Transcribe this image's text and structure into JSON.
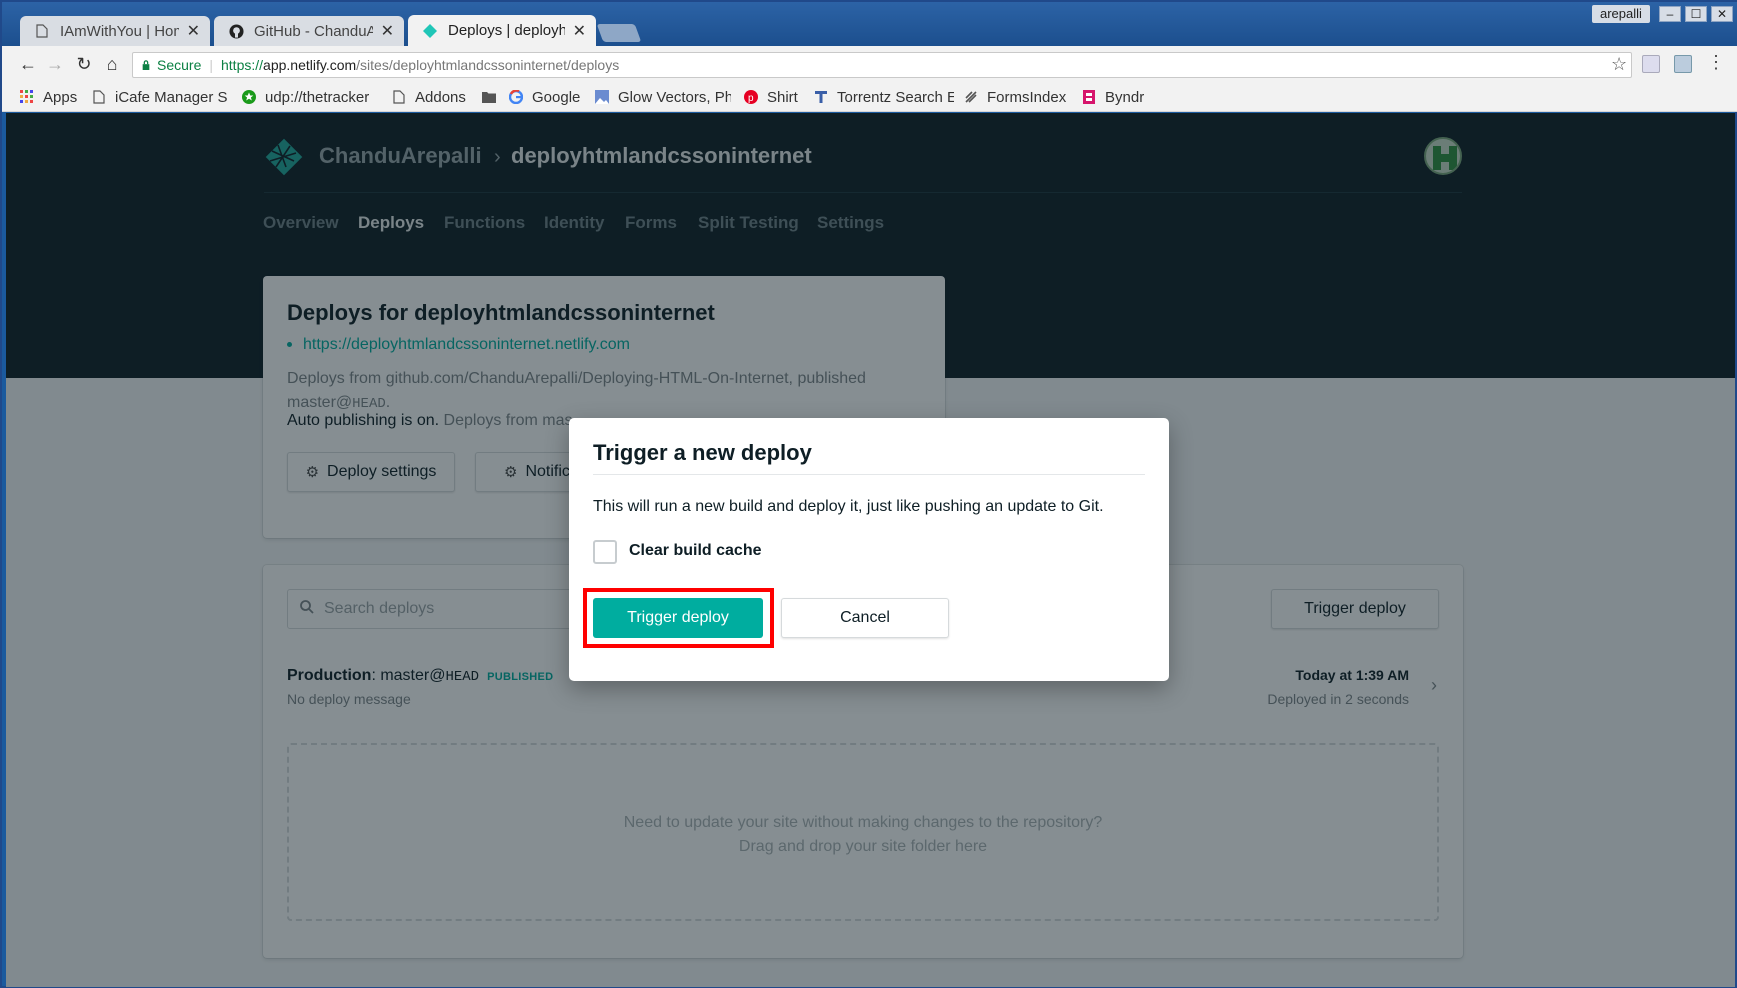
{
  "browser": {
    "tabs": [
      {
        "title": "IAmWithYou | Home",
        "icon": "page-icon"
      },
      {
        "title": "GitHub - ChanduArepalli",
        "icon": "github-icon"
      },
      {
        "title": "Deploys | deployhtmlandcss",
        "icon": "netlify-icon"
      }
    ],
    "close_glyph": "✕",
    "user": "arepalli",
    "window_buttons": [
      "–",
      "☐",
      "✕"
    ],
    "address": {
      "secure_label": "Secure",
      "protocol": "https://",
      "host": "app.netlify.com",
      "path": "/sites/deployhtmlandcssoninternet/deploys"
    },
    "bookmarks": [
      {
        "label": "Apps",
        "icon": "apps-grid-icon"
      },
      {
        "label": "iCafe Manager Se",
        "icon": "page-icon"
      },
      {
        "label": "udp://thetracker",
        "icon": "star-badge-icon"
      },
      {
        "label": "Addons",
        "icon": "page-icon"
      },
      {
        "label": "",
        "icon": "folder-icon"
      },
      {
        "label": "Google",
        "icon": "google-icon"
      },
      {
        "label": "Glow Vectors, Ph",
        "icon": "image-icon"
      },
      {
        "label": "Shirt",
        "icon": "pinterest-icon"
      },
      {
        "label": "Torrentz Search E",
        "icon": "torrentz-icon"
      },
      {
        "label": "FormsIndex",
        "icon": "forms-icon"
      },
      {
        "label": "Byndr",
        "icon": "byndr-icon"
      }
    ]
  },
  "site": {
    "team": "ChanduArepalli",
    "breadcrumb_sep": "›",
    "name": "deployhtmlandcssoninternet",
    "nav": [
      "Overview",
      "Deploys",
      "Functions",
      "Identity",
      "Forms",
      "Split Testing",
      "Settings"
    ],
    "active_nav": "Deploys"
  },
  "deploys_card": {
    "title": "Deploys for deployhtmlandcssoninternet",
    "url": "https://deployhtmlandcssoninternet.netlify.com",
    "desc_prefix": "Deploys from github.com/ChanduArepalli/Deploying-HTML-On-Internet, published",
    "desc_branch": "master@",
    "desc_ref": "HEAD",
    "desc_end": ".",
    "auto_on": "Auto publishing is on.",
    "auto_rest": " Deploys from mas",
    "deploy_settings": "Deploy settings",
    "notifications": "Notifications"
  },
  "deploy_list": {
    "search_placeholder": "Search deploys",
    "trigger_button": "Trigger deploy",
    "production_label": "Production",
    "production_branch": ": master@",
    "production_ref": "HEAD",
    "status_badge": "PUBLISHED",
    "message": "No deploy message",
    "time": "Today at 1:39 AM",
    "duration": "Deployed in 2 seconds",
    "drop_line1": "Need to update your site without making changes to the repository?",
    "drop_line2": "Drag and drop your site folder here"
  },
  "modal": {
    "title": "Trigger a new deploy",
    "text": "This will run a new build and deploy it, just like pushing an update to Git.",
    "checkbox_label": "Clear build cache",
    "checkbox_checked": false,
    "primary": "Trigger deploy",
    "cancel": "Cancel"
  },
  "colors": {
    "accent": "#00ad9f",
    "hero_bg": "#0e1e25",
    "highlight": "#ff0000"
  }
}
